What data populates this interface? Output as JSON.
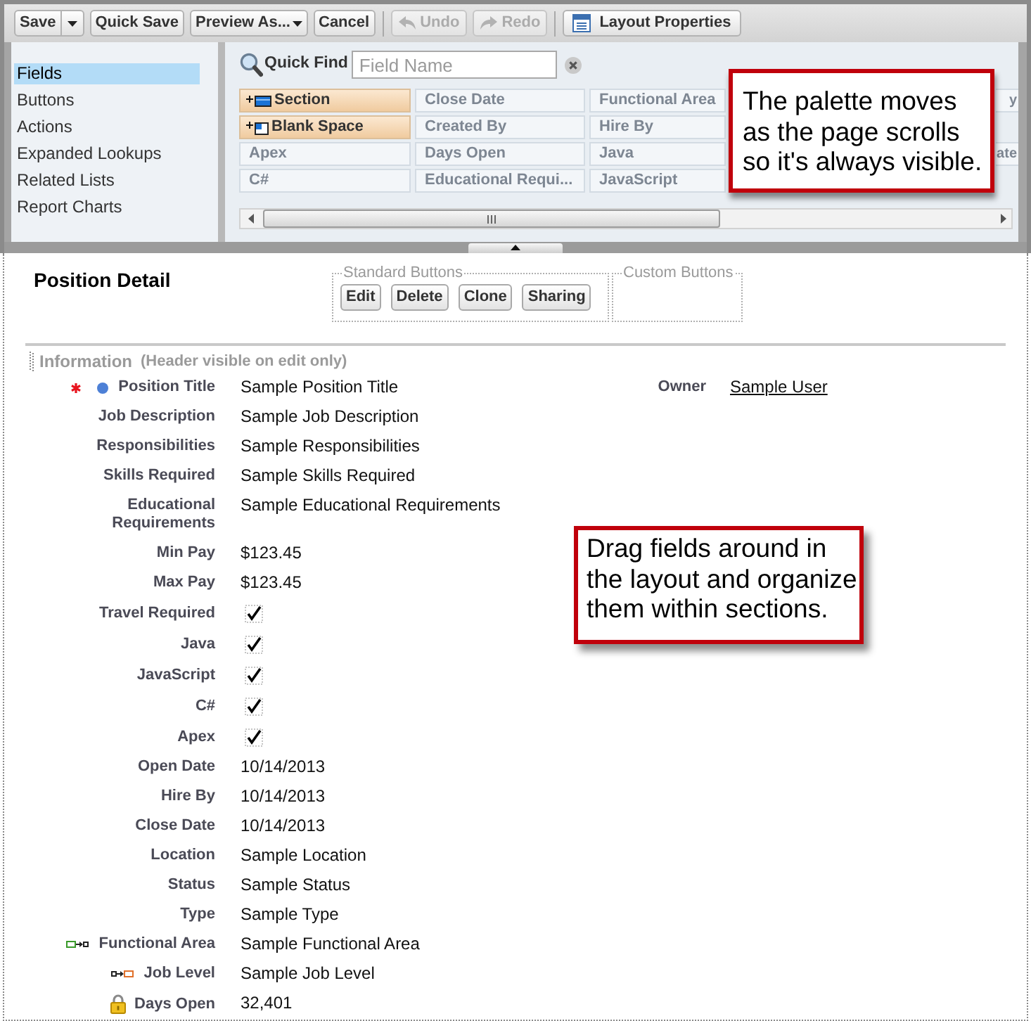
{
  "toolbar": {
    "groups": [
      [
        {
          "label": "Save",
          "kind": "split",
          "disabled": false
        },
        {
          "label": "Quick Save",
          "kind": "plain",
          "disabled": false
        },
        {
          "label": "Preview As...",
          "kind": "menu",
          "disabled": false
        },
        {
          "label": "Cancel",
          "kind": "plain",
          "disabled": false
        }
      ],
      [
        {
          "label": "Undo",
          "kind": "undo",
          "disabled": true
        },
        {
          "label": "Redo",
          "kind": "redo",
          "disabled": true
        }
      ],
      [
        {
          "label": "Layout Properties",
          "kind": "properties",
          "disabled": false
        }
      ]
    ]
  },
  "palette": {
    "categories": [
      {
        "label": "Fields",
        "selected": true
      },
      {
        "label": "Buttons",
        "selected": false
      },
      {
        "label": "Actions",
        "selected": false
      },
      {
        "label": "Expanded Lookups",
        "selected": false
      },
      {
        "label": "Related Lists",
        "selected": false
      },
      {
        "label": "Report Charts",
        "selected": false
      }
    ],
    "quick_find": {
      "label": "Quick Find",
      "placeholder": "Field Name"
    },
    "columns": [
      [
        {
          "label": "Section",
          "kind": "section"
        },
        {
          "label": "Blank Space",
          "kind": "blank"
        },
        {
          "label": "Apex",
          "kind": "field"
        },
        {
          "label": "C#",
          "kind": "field"
        }
      ],
      [
        {
          "label": "Close Date",
          "kind": "field"
        },
        {
          "label": "Created By",
          "kind": "field"
        },
        {
          "label": "Days Open",
          "kind": "field"
        },
        {
          "label": "Educational Requi...",
          "kind": "field"
        }
      ],
      [
        {
          "label": "Functional Area",
          "kind": "field"
        },
        {
          "label": "Hire By",
          "kind": "field"
        },
        {
          "label": "Java",
          "kind": "field"
        },
        {
          "label": "JavaScript",
          "kind": "field"
        }
      ]
    ],
    "column_5": [
      {
        "label": "y"
      },
      {
        "label": "ate"
      }
    ],
    "callout": "The palette moves\nas the page scrolls\nso it's always visible."
  },
  "layout": {
    "title": "Position Detail",
    "standard_buttons": {
      "legend": "Standard Buttons",
      "buttons": [
        "Edit",
        "Delete",
        "Clone",
        "Sharing"
      ]
    },
    "custom_buttons": {
      "legend": "Custom Buttons"
    },
    "section": {
      "title": "Information",
      "note": "(Header visible on edit only)",
      "fields": [
        {
          "label": "Position Title",
          "value": "Sample Position Title",
          "kind": "text",
          "required": true,
          "layout_required": true,
          "read_only": false,
          "controlling": false,
          "dependent": false
        },
        {
          "label": "Job Description",
          "value": "Sample Job Description",
          "kind": "text",
          "required": false,
          "layout_required": false,
          "read_only": false,
          "controlling": false,
          "dependent": false
        },
        {
          "label": "Responsibilities",
          "value": "Sample Responsibilities",
          "kind": "text",
          "required": false,
          "layout_required": false,
          "read_only": false,
          "controlling": false,
          "dependent": false
        },
        {
          "label": "Skills Required",
          "value": "Sample Skills Required",
          "kind": "text",
          "required": false,
          "layout_required": false,
          "read_only": false,
          "controlling": false,
          "dependent": false
        },
        {
          "label": "Educational Requirements",
          "value": "Sample Educational Requirements",
          "kind": "text",
          "required": false,
          "layout_required": false,
          "read_only": false,
          "controlling": false,
          "dependent": false
        },
        {
          "label": "Min Pay",
          "value": "$123.45",
          "kind": "text",
          "required": false,
          "layout_required": false,
          "read_only": false,
          "controlling": false,
          "dependent": false
        },
        {
          "label": "Max Pay",
          "value": "$123.45",
          "kind": "text",
          "required": false,
          "layout_required": false,
          "read_only": false,
          "controlling": false,
          "dependent": false
        },
        {
          "label": "Travel Required",
          "kind": "checkbox",
          "checked": true,
          "required": false,
          "layout_required": false,
          "read_only": false,
          "controlling": false,
          "dependent": false
        },
        {
          "label": "Java",
          "kind": "checkbox",
          "checked": true,
          "required": false,
          "layout_required": false,
          "read_only": false,
          "controlling": false,
          "dependent": false
        },
        {
          "label": "JavaScript",
          "kind": "checkbox",
          "checked": true,
          "required": false,
          "layout_required": false,
          "read_only": false,
          "controlling": false,
          "dependent": false
        },
        {
          "label": "C#",
          "kind": "checkbox",
          "checked": true,
          "required": false,
          "layout_required": false,
          "read_only": false,
          "controlling": false,
          "dependent": false
        },
        {
          "label": "Apex",
          "kind": "checkbox",
          "checked": true,
          "required": false,
          "layout_required": false,
          "read_only": false,
          "controlling": false,
          "dependent": false
        },
        {
          "label": "Open Date",
          "value": "10/14/2013",
          "kind": "text",
          "required": false,
          "layout_required": false,
          "read_only": false,
          "controlling": false,
          "dependent": false
        },
        {
          "label": "Hire By",
          "value": "10/14/2013",
          "kind": "text",
          "required": false,
          "layout_required": false,
          "read_only": false,
          "controlling": false,
          "dependent": false
        },
        {
          "label": "Close Date",
          "value": "10/14/2013",
          "kind": "text",
          "required": false,
          "layout_required": false,
          "read_only": false,
          "controlling": false,
          "dependent": false
        },
        {
          "label": "Location",
          "value": "Sample Location",
          "kind": "text",
          "required": false,
          "layout_required": false,
          "read_only": false,
          "controlling": false,
          "dependent": false
        },
        {
          "label": "Status",
          "value": "Sample Status",
          "kind": "text",
          "required": false,
          "layout_required": false,
          "read_only": false,
          "controlling": false,
          "dependent": false
        },
        {
          "label": "Type",
          "value": "Sample Type",
          "kind": "text",
          "required": false,
          "layout_required": false,
          "read_only": false,
          "controlling": false,
          "dependent": false
        },
        {
          "label": "Functional Area",
          "value": "Sample Functional Area",
          "kind": "text",
          "required": false,
          "layout_required": false,
          "read_only": false,
          "controlling": true,
          "dependent": false
        },
        {
          "label": "Job Level",
          "value": "Sample Job Level",
          "kind": "text",
          "required": false,
          "layout_required": false,
          "read_only": false,
          "controlling": false,
          "dependent": true
        },
        {
          "label": "Days Open",
          "value": "32,401",
          "kind": "text",
          "required": false,
          "layout_required": false,
          "read_only": true,
          "controlling": false,
          "dependent": false
        }
      ],
      "right_fields": [
        {
          "label": "Owner",
          "value": "Sample User",
          "kind": "link"
        }
      ]
    },
    "callout": "Drag fields around in\nthe layout and organize\nthem within sections."
  }
}
